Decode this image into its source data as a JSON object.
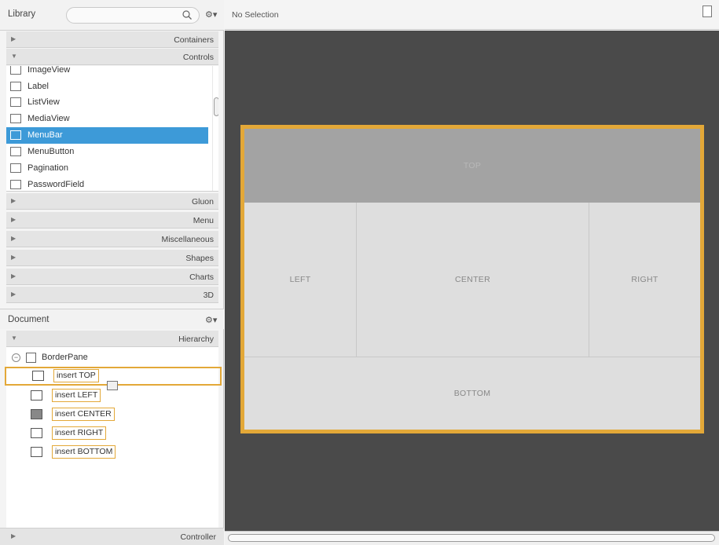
{
  "library": {
    "title": "Library",
    "search_placeholder": "",
    "gear_label": "⚙▾"
  },
  "sections_top": [
    {
      "label": "Containers",
      "expanded": false
    },
    {
      "label": "Controls",
      "expanded": true
    }
  ],
  "controls": [
    {
      "label": "ImageView",
      "icon": "imageview-icon",
      "selected": false
    },
    {
      "label": "Label",
      "icon": "label-icon",
      "selected": false
    },
    {
      "label": "ListView",
      "icon": "listview-icon",
      "selected": false
    },
    {
      "label": "MediaView",
      "icon": "mediaview-icon",
      "selected": false
    },
    {
      "label": "MenuBar",
      "icon": "menubar-icon",
      "selected": true
    },
    {
      "label": "MenuButton",
      "icon": "menubutton-icon",
      "selected": false
    },
    {
      "label": "Pagination",
      "icon": "pagination-icon",
      "selected": false
    },
    {
      "label": "PasswordField",
      "icon": "passwordfield-icon",
      "selected": false
    }
  ],
  "sections_bottom": [
    {
      "label": "Gluon"
    },
    {
      "label": "Menu"
    },
    {
      "label": "Miscellaneous"
    },
    {
      "label": "Shapes"
    },
    {
      "label": "Charts"
    },
    {
      "label": "3D"
    }
  ],
  "document": {
    "title": "Document",
    "gear_label": "⚙▾",
    "hierarchy_label": "Hierarchy"
  },
  "tree": {
    "root_label": "BorderPane",
    "inserts": [
      {
        "label": "insert TOP",
        "highlight": true
      },
      {
        "label": "insert LEFT",
        "highlight": false
      },
      {
        "label": "insert CENTER",
        "highlight": false
      },
      {
        "label": "insert RIGHT",
        "highlight": false
      },
      {
        "label": "insert BOTTOM",
        "highlight": false
      }
    ]
  },
  "controller": {
    "label": "Controller"
  },
  "topbar": {
    "selection": "No Selection"
  },
  "canvas": {
    "regions": {
      "top": "TOP",
      "left": "LEFT",
      "center": "CENTER",
      "right": "RIGHT",
      "bottom": "BOTTOM"
    }
  },
  "colors": {
    "accent": "#e3a838",
    "selected": "#3d9ad8",
    "canvas_bg": "#4a4a4a"
  }
}
